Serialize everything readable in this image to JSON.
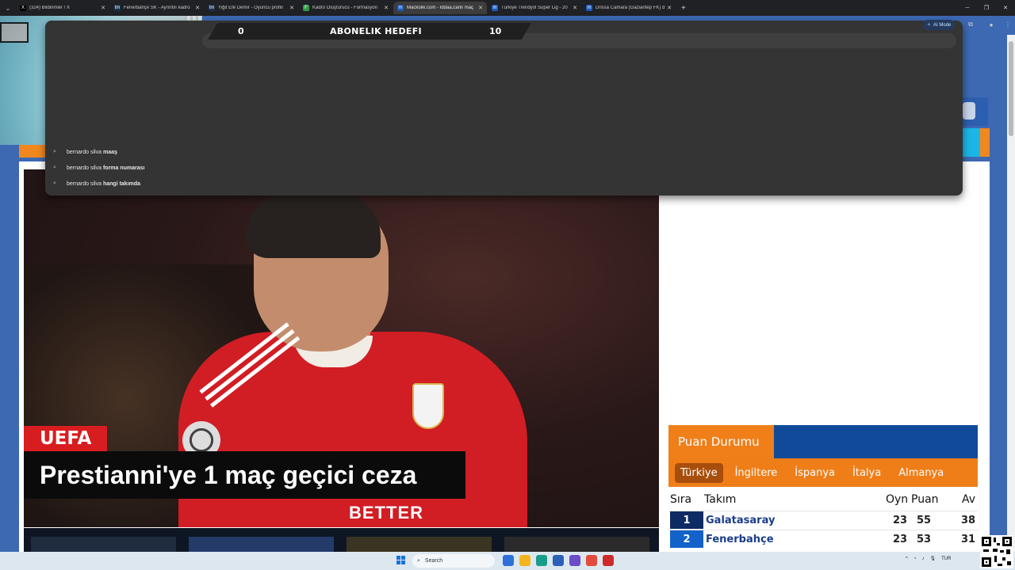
{
  "browser": {
    "tabs": [
      {
        "label": "(324) Bildirimler / X",
        "favicon": "x-icon",
        "color": "#000000",
        "glyph": "X",
        "active": false
      },
      {
        "label": "Fenerbahçe SK - Ayrıntılı kadro",
        "favicon": "transfermarkt-icon",
        "color": "#1a3151",
        "glyph": "tm",
        "active": false
      },
      {
        "label": "Yiğit Efe Demir - Oyuncu profili",
        "favicon": "transfermarkt-icon",
        "color": "#1a3151",
        "glyph": "tm",
        "active": false
      },
      {
        "label": "Kadro Oluşturucu - Formasyon",
        "favicon": "lineup-icon",
        "color": "#2e9b45",
        "glyph": "F",
        "active": false
      },
      {
        "label": "Mackolik.com - İddaa,canlı maç",
        "favicon": "mackolik-icon",
        "color": "#1d5bbf",
        "glyph": "m",
        "active": true
      },
      {
        "label": "Türkiye Trendyol Süper Lig - 20",
        "favicon": "mackolik-icon",
        "color": "#1d5bbf",
        "glyph": "m",
        "active": false
      },
      {
        "label": "Drissa Camara (Gaziantep FK) d",
        "favicon": "mackolik-icon",
        "color": "#1d5bbf",
        "glyph": "m",
        "active": false
      }
    ],
    "new_tab": "+",
    "ai_mode_label": "AI Mode"
  },
  "subscription": {
    "left_value": "0",
    "title": "ABONELIK HEDEFI",
    "right_value": "10"
  },
  "omnibox": {
    "suggestions": [
      {
        "prefix": "bernardo silva",
        "suffix": "maaş"
      },
      {
        "prefix": "bernardo silva",
        "suffix": "forma numarası"
      },
      {
        "prefix": "bernardo silva",
        "suffix": "hangi takımda"
      }
    ]
  },
  "news": {
    "category": "UEFA",
    "headline": "Prestianni'ye 1 maç geçici ceza",
    "jersey_sponsor": "FLY BETTER"
  },
  "standings": {
    "title": "Puan Durumu",
    "tabs": [
      "Türkiye",
      "İngiltere",
      "İspanya",
      "İtalya",
      "Almanya"
    ],
    "selected_tab": "Türkiye",
    "columns": {
      "rank": "Sıra",
      "team": "Takım",
      "played": "Oyn",
      "points": "Puan",
      "avg": "Av"
    },
    "rows": [
      {
        "rank": "1",
        "team": "Galatasaray",
        "played": "23",
        "points": "55",
        "avg": "38"
      },
      {
        "rank": "2",
        "team": "Fenerbahçe",
        "played": "23",
        "points": "53",
        "avg": "31"
      }
    ]
  },
  "taskbar": {
    "search_placeholder": "Search",
    "language": "TUR"
  },
  "colors": {
    "accent_orange": "#f07f19",
    "brand_blue": "#124a9a",
    "news_red": "#d81d20"
  }
}
